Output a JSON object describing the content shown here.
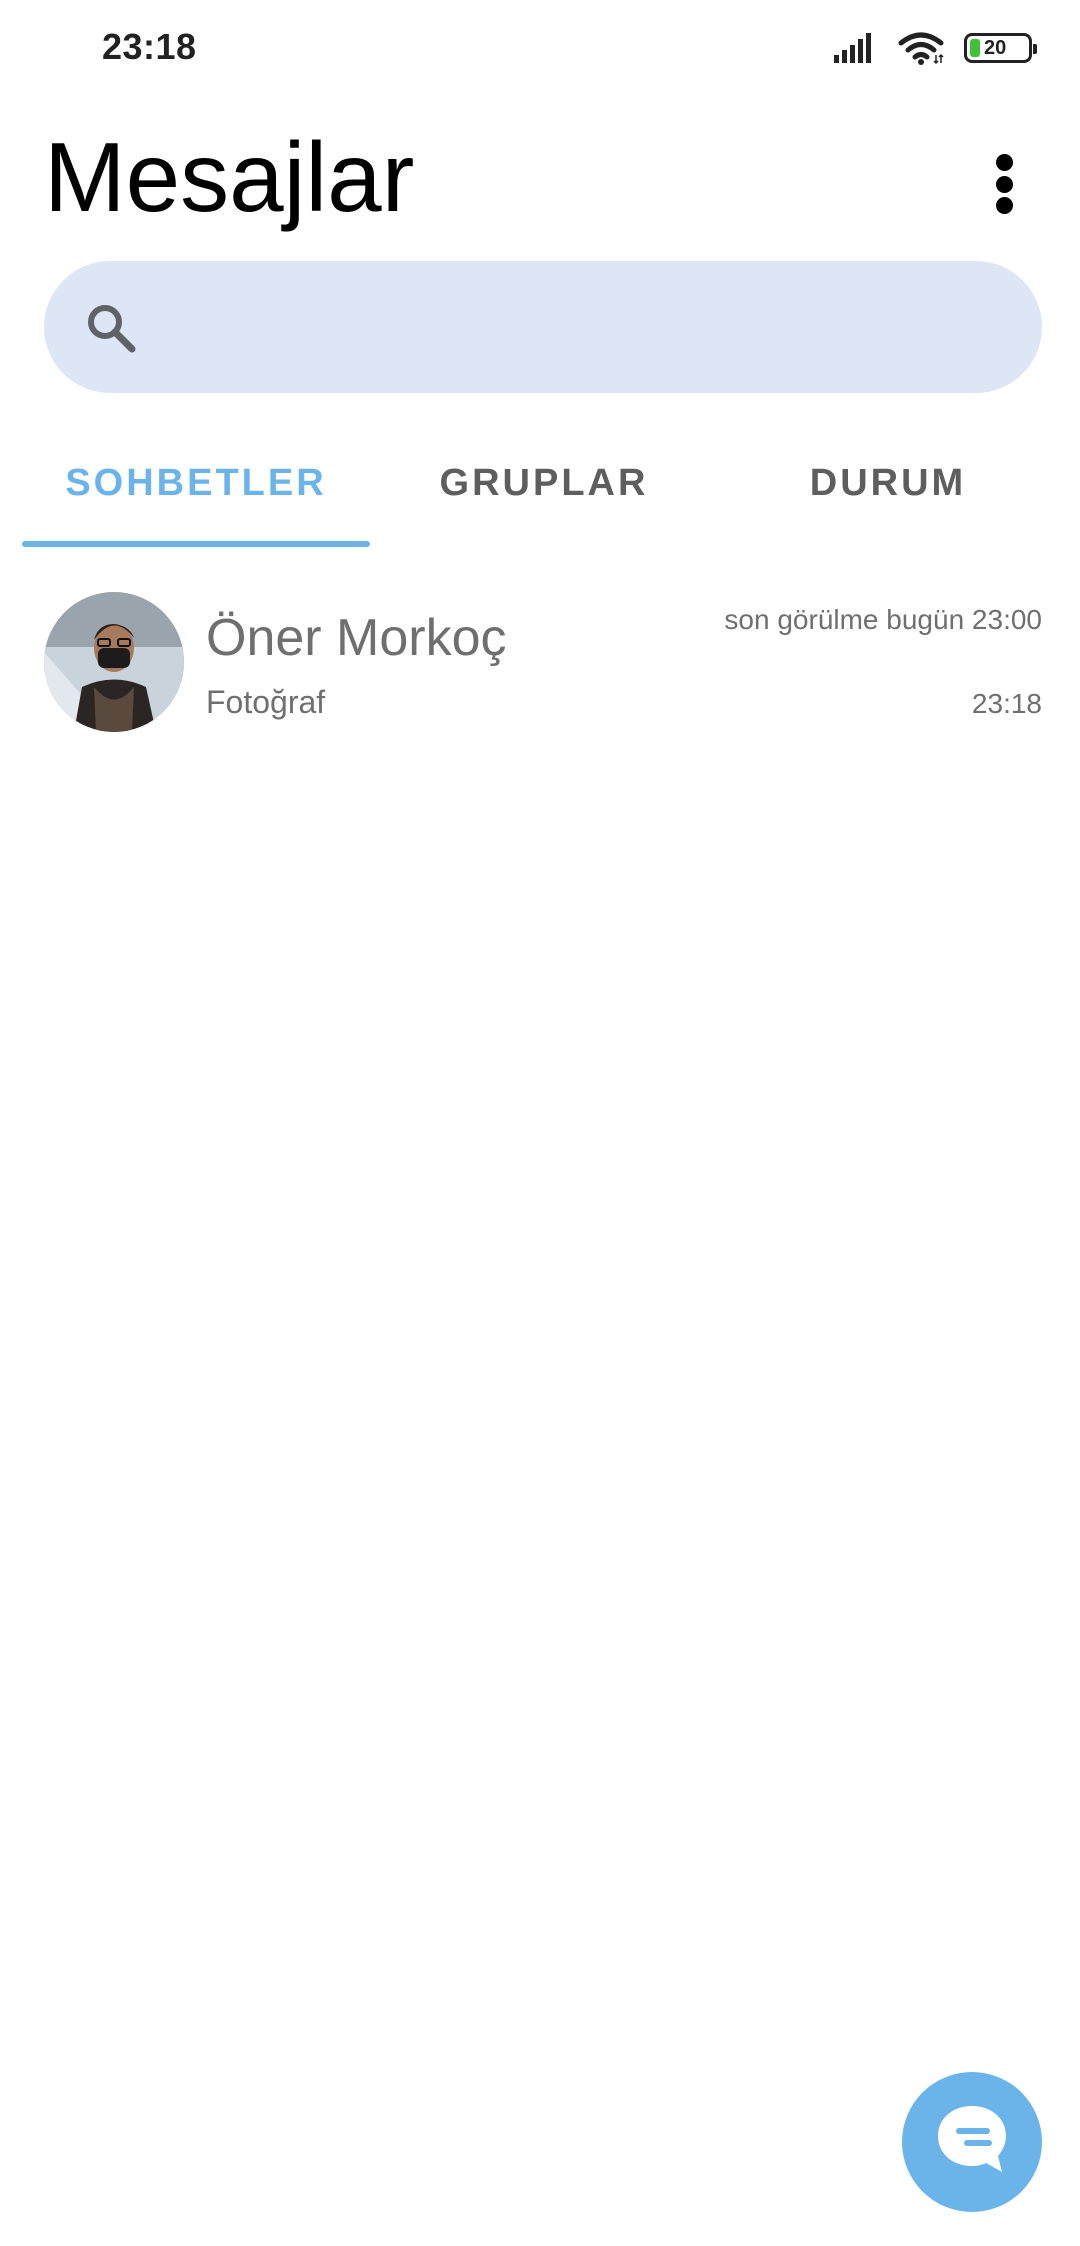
{
  "status_bar": {
    "time": "23:18",
    "battery_level": "20",
    "icons": [
      "signal-icon",
      "wifi-icon",
      "battery-icon"
    ]
  },
  "header": {
    "title": "Mesajlar",
    "menu_icon": "more-vertical-icon"
  },
  "search": {
    "placeholder": "",
    "value": "",
    "icon": "search-icon"
  },
  "tabs": [
    {
      "label": "SOHBETLER",
      "active": true
    },
    {
      "label": "GRUPLAR",
      "active": false
    },
    {
      "label": "DURUM",
      "active": false
    }
  ],
  "chats": [
    {
      "name": "Öner Morkoç",
      "last_seen": "son görülme bugün 23:00",
      "preview": "Fotoğraf",
      "time": "23:18",
      "avatar": "avatar-photo"
    }
  ],
  "fab": {
    "icon": "new-message-icon"
  },
  "colors": {
    "accent": "#6ab4ea",
    "search_background": "#dce6f5",
    "inactive_tab": "#5e5e5e",
    "secondary_text": "#6f6f6f",
    "battery_fill": "#3fbf3a"
  }
}
